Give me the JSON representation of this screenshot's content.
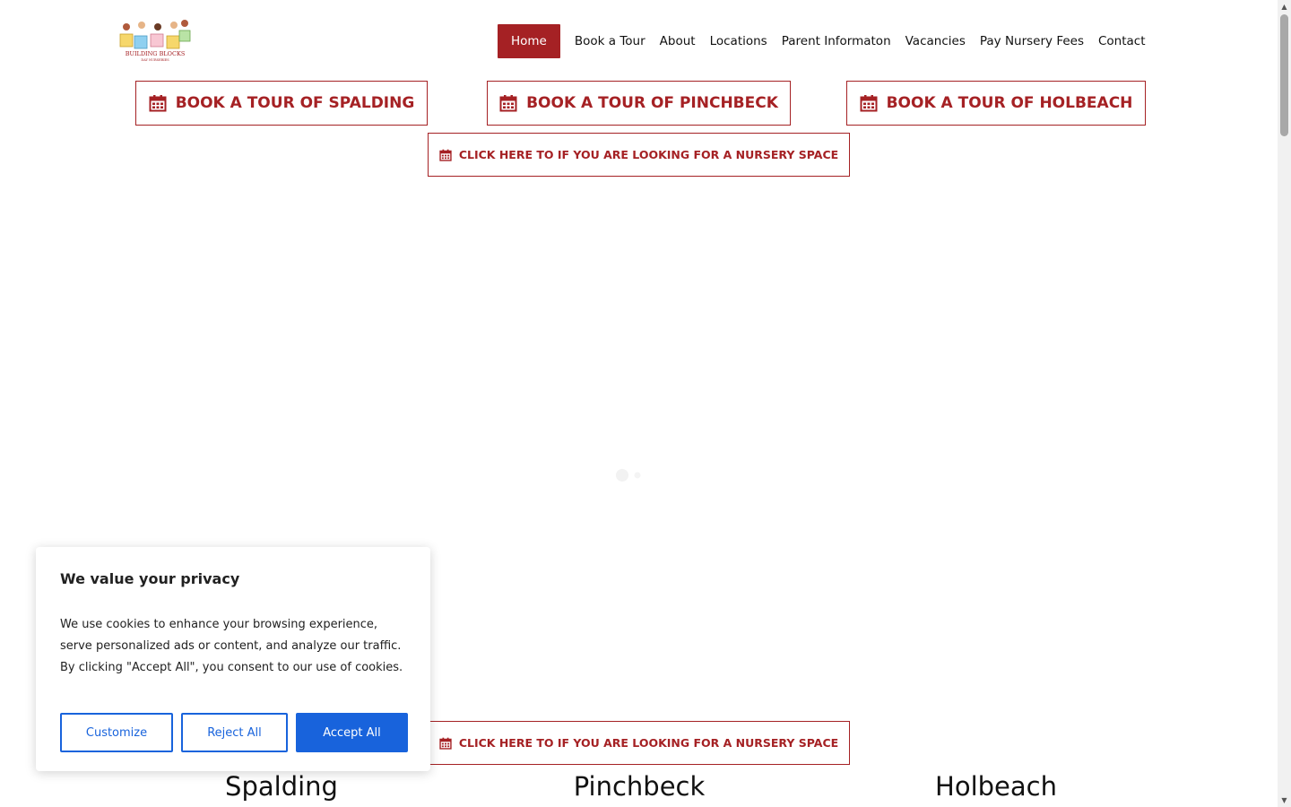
{
  "nav": {
    "items": [
      {
        "label": "Home",
        "active": true
      },
      {
        "label": "Book a Tour",
        "active": false
      },
      {
        "label": "About",
        "active": false
      },
      {
        "label": "Locations",
        "active": false
      },
      {
        "label": "Parent Informaton",
        "active": false
      },
      {
        "label": "Vacancies",
        "active": false
      },
      {
        "label": "Pay Nursery Fees",
        "active": false
      },
      {
        "label": "Contact",
        "active": false
      }
    ]
  },
  "tours": {
    "spalding": "BOOK A TOUR OF SPALDING",
    "pinchbeck": "BOOK A TOUR OF PINCHBECK",
    "holbeach": "BOOK A TOUR OF HOLBEACH"
  },
  "nursery_space_label": "CLICK HERE TO IF YOU ARE LOOKING FOR A NURSERY SPACE",
  "locations": [
    "Spalding",
    "Pinchbeck",
    "Holbeach"
  ],
  "cookie": {
    "title": "We value your privacy",
    "text": "We use cookies to enhance your browsing experience, serve personalized ads or content, and analyze our traffic. By clicking \"Accept All\", you consent to our use of cookies.",
    "customize": "Customize",
    "reject": "Reject All",
    "accept": "Accept All"
  },
  "colors": {
    "brand": "#a52124",
    "cookie_accent": "#1863dc"
  },
  "icons": {
    "tour_button": "calendar-icon"
  }
}
